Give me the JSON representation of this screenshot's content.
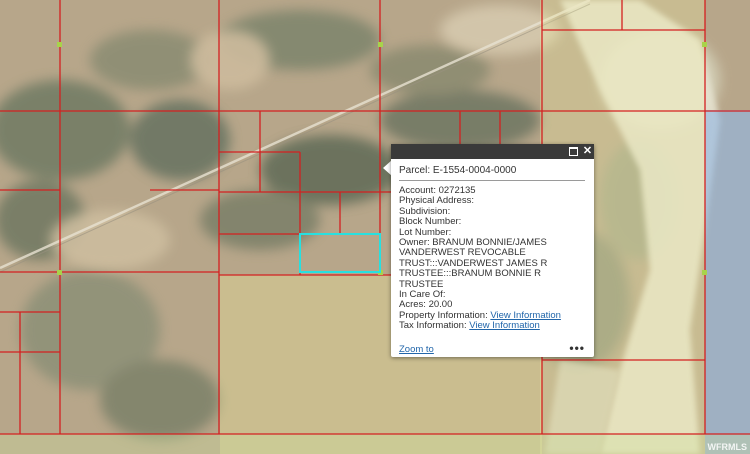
{
  "popup": {
    "title_prefix": "Parcel:",
    "parcel_id": "E-1554-0004-0000",
    "fields": [
      {
        "label": "Account:",
        "value": "0272135"
      },
      {
        "label": "Physical Address:",
        "value": ""
      },
      {
        "label": "Subdivision:",
        "value": ""
      },
      {
        "label": "Block Number:",
        "value": ""
      },
      {
        "label": "Lot Number:",
        "value": ""
      }
    ],
    "owner_label": "Owner:",
    "owner_value": "BRANUM BONNIE/JAMES VANDERWEST REVOCABLE TRUST:::VANDERWEST JAMES R TRUSTEE:::BRANUM BONNIE R TRUSTEE",
    "care_label": "In Care Of:",
    "care_value": "",
    "acres_label": "Acres:",
    "acres_value": "20.00",
    "property_label": "Property Information:",
    "property_link": "View Information",
    "tax_label": "Tax Information:",
    "tax_link": "View Information",
    "zoom_label": "Zoom to",
    "more_label": "•••"
  },
  "watermark": "WFRMLS",
  "colors": {
    "parcel_lines": "#d42020",
    "selected_parcel": "#27e0e0",
    "header_bg": "#3a3a3a",
    "link": "#2266aa"
  },
  "icons": {
    "maximize": "maximize-icon",
    "close": "close-icon"
  }
}
